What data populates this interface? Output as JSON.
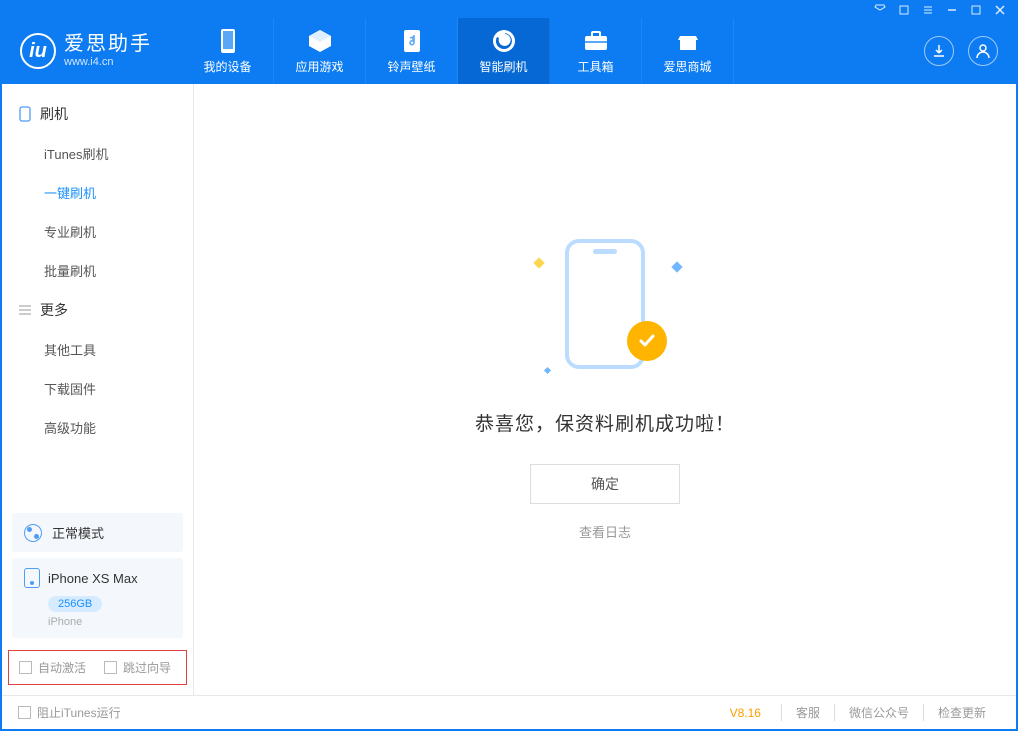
{
  "app": {
    "name_cn": "爱思助手",
    "name_en": "www.i4.cn"
  },
  "nav": [
    {
      "label": "我的设备"
    },
    {
      "label": "应用游戏"
    },
    {
      "label": "铃声壁纸"
    },
    {
      "label": "智能刷机"
    },
    {
      "label": "工具箱"
    },
    {
      "label": "爱思商城"
    }
  ],
  "sidebar": {
    "group1_title": "刷机",
    "group1": [
      {
        "label": "iTunes刷机"
      },
      {
        "label": "一键刷机"
      },
      {
        "label": "专业刷机"
      },
      {
        "label": "批量刷机"
      }
    ],
    "group2_title": "更多",
    "group2": [
      {
        "label": "其他工具"
      },
      {
        "label": "下载固件"
      },
      {
        "label": "高级功能"
      }
    ]
  },
  "status": {
    "mode": "正常模式"
  },
  "device": {
    "name": "iPhone XS Max",
    "storage": "256GB",
    "type": "iPhone"
  },
  "checkboxes": {
    "auto_activate": "自动激活",
    "skip_guide": "跳过向导"
  },
  "main": {
    "success_text": "恭喜您，保资料刷机成功啦！",
    "ok_button": "确定",
    "view_log": "查看日志"
  },
  "footer": {
    "block_itunes": "阻止iTunes运行",
    "version": "V8.16",
    "links": [
      "客服",
      "微信公众号",
      "检查更新"
    ]
  }
}
